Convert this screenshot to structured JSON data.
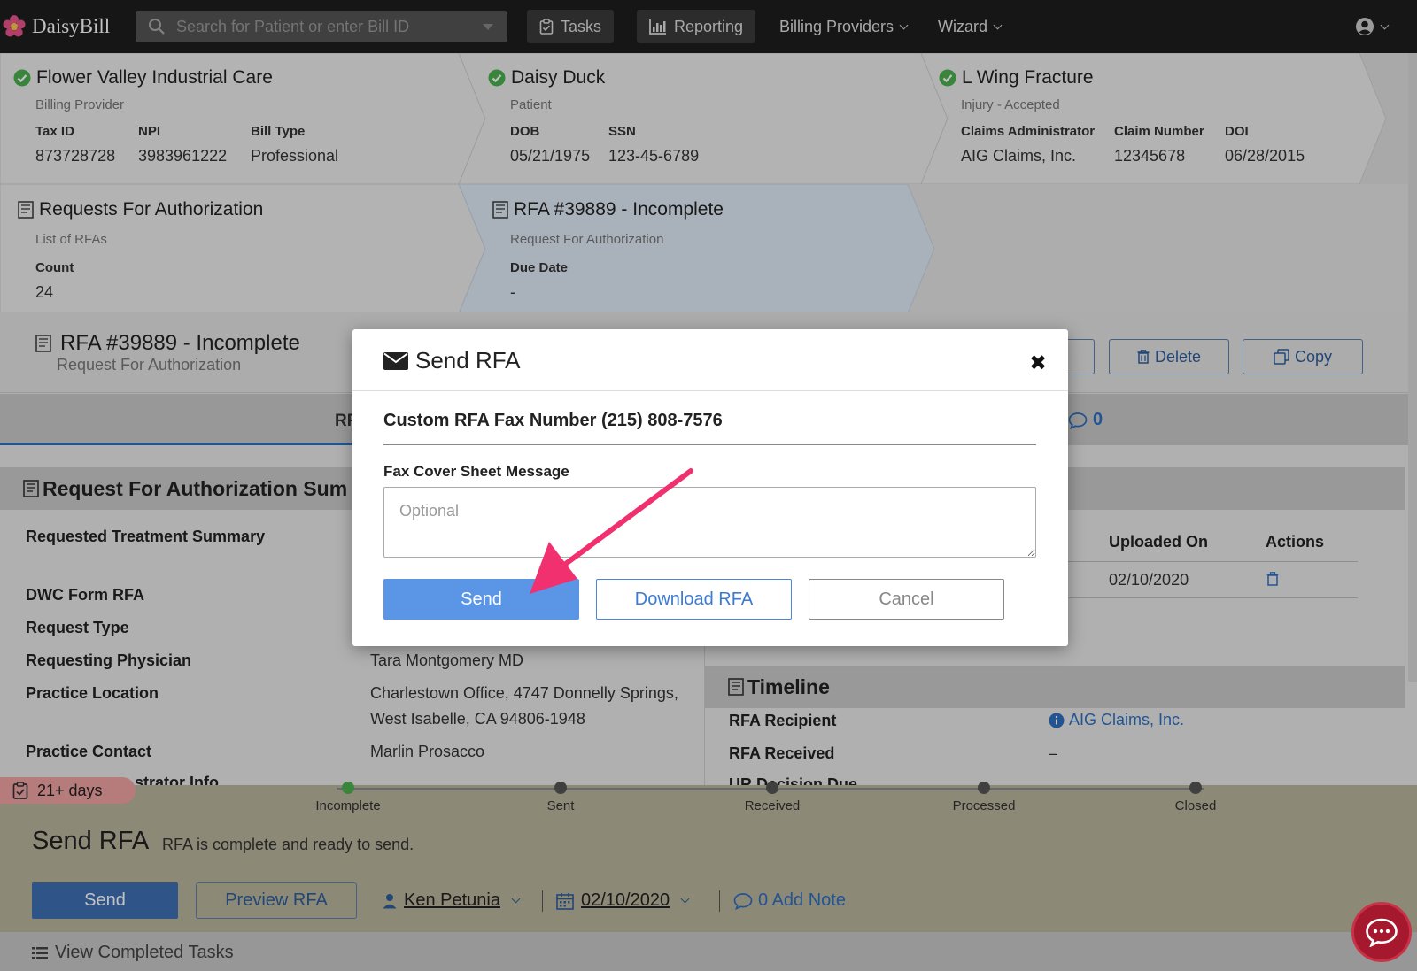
{
  "app": {
    "name": "DaisyBill",
    "search_placeholder": "Search for Patient or enter Bill ID",
    "nav": {
      "tasks": "Tasks",
      "reporting": "Reporting",
      "billing_providers": "Billing Providers",
      "wizard": "Wizard"
    }
  },
  "breadcrumbs": {
    "provider": {
      "title": "Flower Valley Industrial Care",
      "subtitle": "Billing Provider",
      "fields": [
        {
          "label": "Tax ID",
          "value": "873728728"
        },
        {
          "label": "NPI",
          "value": "3983961222"
        },
        {
          "label": "Bill Type",
          "value": "Professional"
        }
      ]
    },
    "patient": {
      "title": "Daisy Duck",
      "subtitle": "Patient",
      "fields": [
        {
          "label": "DOB",
          "value": "05/21/1975"
        },
        {
          "label": "SSN",
          "value": "123-45-6789"
        }
      ]
    },
    "injury": {
      "title": "L Wing Fracture",
      "subtitle": "Injury - Accepted",
      "fields": [
        {
          "label": "Claims Administrator",
          "value": "AIG Claims, Inc."
        },
        {
          "label": "Claim Number",
          "value": "12345678"
        },
        {
          "label": "DOI",
          "value": "06/28/2015"
        }
      ]
    },
    "rfas": {
      "title": "Requests For Authorization",
      "subtitle": "List of RFAs",
      "fields": [
        {
          "label": "Count",
          "value": "24"
        }
      ]
    },
    "rfa": {
      "title": "RFA #39889 - Incomplete",
      "subtitle": "Request For Authorization",
      "fields": [
        {
          "label": "Due Date",
          "value": "-"
        }
      ]
    }
  },
  "page_header": {
    "title": "RFA #39889 - Incomplete",
    "subtitle": "Request For Authorization",
    "delete_label": "Delete",
    "copy_label": "Copy"
  },
  "tabs": {
    "active_partial": "RF",
    "comments_count": "0"
  },
  "summary": {
    "heading_partial": "Request For Authorization Sum",
    "rows": [
      {
        "label": "Requested Treatment Summary",
        "value": ""
      },
      {
        "label": "DWC Form RFA",
        "value": ""
      },
      {
        "label": "Request Type",
        "value": ""
      },
      {
        "label": "Requesting Physician",
        "value": "Tara Montgomery MD"
      },
      {
        "label": "Practice Location",
        "value": "Charlestown Office, 4747 Donnelly Springs,",
        "value2": "West Isabelle, CA 94806-1948"
      },
      {
        "label": "Practice Contact",
        "value": "Marlin Prosacco"
      },
      {
        "label": "strator Info",
        "value": ""
      }
    ]
  },
  "documents": {
    "col_uploaded": "Uploaded On",
    "col_actions": "Actions",
    "row_date": "02/10/2020"
  },
  "timeline": {
    "heading": "Timeline",
    "rows": [
      {
        "label": "RFA Recipient",
        "value": "AIG Claims, Inc."
      },
      {
        "label": "RFA Received",
        "value": "–"
      },
      {
        "label": "UR Decision Due",
        "value": ""
      }
    ]
  },
  "task": {
    "age_badge": "21+ days",
    "steps": [
      "Incomplete",
      "Sent",
      "Received",
      "Processed",
      "Closed"
    ],
    "title": "Send RFA",
    "description": "RFA is complete and ready to send.",
    "send_label": "Send",
    "preview_label": "Preview RFA",
    "assignee": "Ken Petunia",
    "date": "02/10/2020",
    "notes": "0 Add Note",
    "completed_link": "View Completed Tasks"
  },
  "modal": {
    "title": "Send RFA",
    "fax_line": "Custom RFA Fax Number (215) 808-7576",
    "message_label": "Fax Cover Sheet Message",
    "message_placeholder": "Optional",
    "message_value": "",
    "send_label": "Send",
    "download_label": "Download RFA",
    "cancel_label": "Cancel"
  },
  "colors": {
    "topbar": "#1e1e1e",
    "primary_button": "#5b95e5",
    "link_blue": "#3d7ad1",
    "check_green": "#4caf50",
    "annotation_arrow": "#f0306f",
    "chat_bubble": "#a5182e"
  },
  "icons": [
    "logo-flower-icon",
    "search-icon",
    "clipboard-icon",
    "bar-chart-icon",
    "user-circle-icon",
    "check-circle-icon",
    "form-icon",
    "trash-icon",
    "copy-icon",
    "comment-icon",
    "envelope-icon",
    "close-icon",
    "info-icon",
    "user-icon",
    "calendar-icon",
    "list-icon",
    "chat-icon"
  ]
}
